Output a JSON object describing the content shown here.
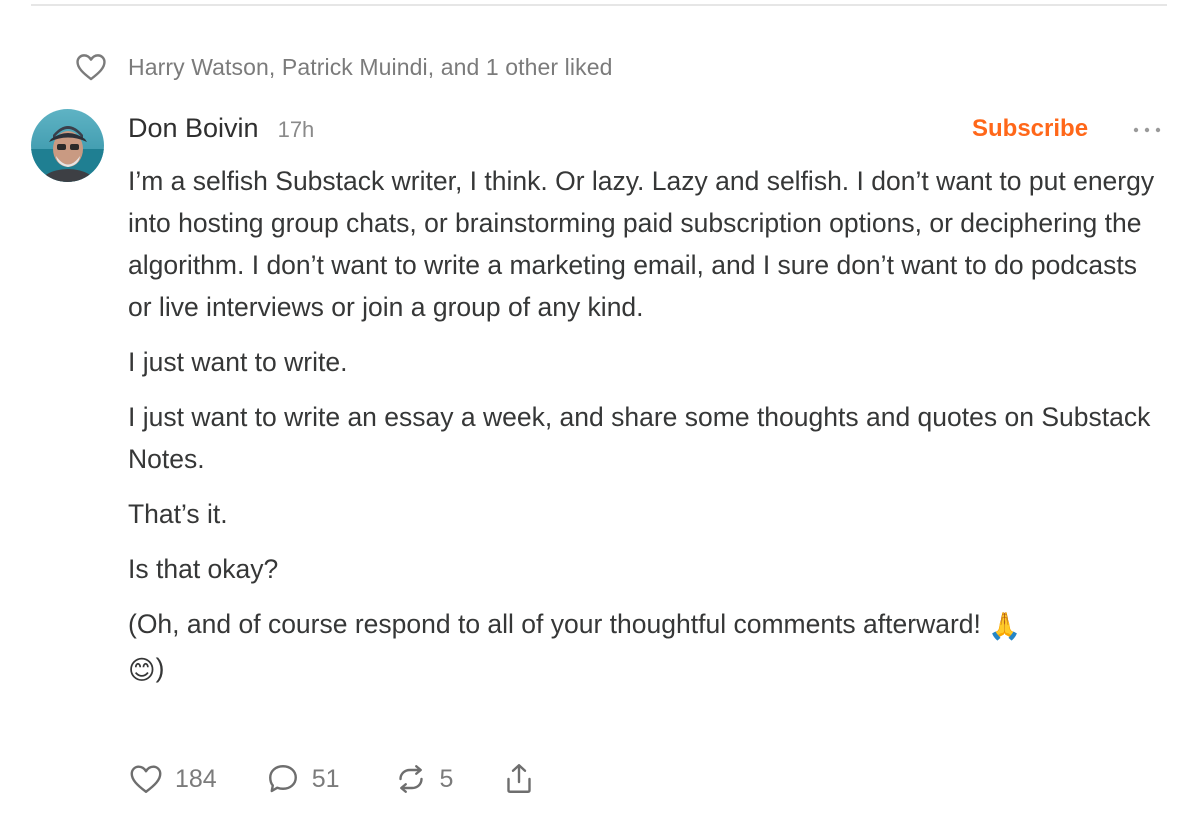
{
  "liked": {
    "text": "Harry Watson, Patrick Muindi, and 1 other liked",
    "icon": "heart-outline-icon"
  },
  "post": {
    "author": "Don Boivin",
    "time": "17h",
    "subscribe_label": "Subscribe",
    "more_icon": "ellipsis-icon",
    "paragraphs": [
      "I’m a selfish Substack writer, I think. Or lazy. Lazy and selfish. I don’t want to put energy into hosting group chats, or brainstorming paid subscription options, or deciphering the algorithm. I don’t want to write a marketing email, and I sure don’t want to do podcasts or live interviews or join a group of any kind.",
      "I just want to write.",
      "I just want to write an essay a week, and share some thoughts and quotes on Substack Notes.",
      "That’s it.",
      "Is that okay?"
    ],
    "last_paragraph": {
      "text": "(Oh, and of course respond to all of your thoughtful comments afterward!",
      "emoji_1": "🙏",
      "emoji_2": "😊",
      "closing": ")"
    }
  },
  "actions": {
    "likes": "184",
    "comments": "51",
    "restacks": "5"
  },
  "colors": {
    "accent": "#ff6719",
    "text": "#363737",
    "muted": "#7b7b7b",
    "divider": "#e6e6e6"
  }
}
